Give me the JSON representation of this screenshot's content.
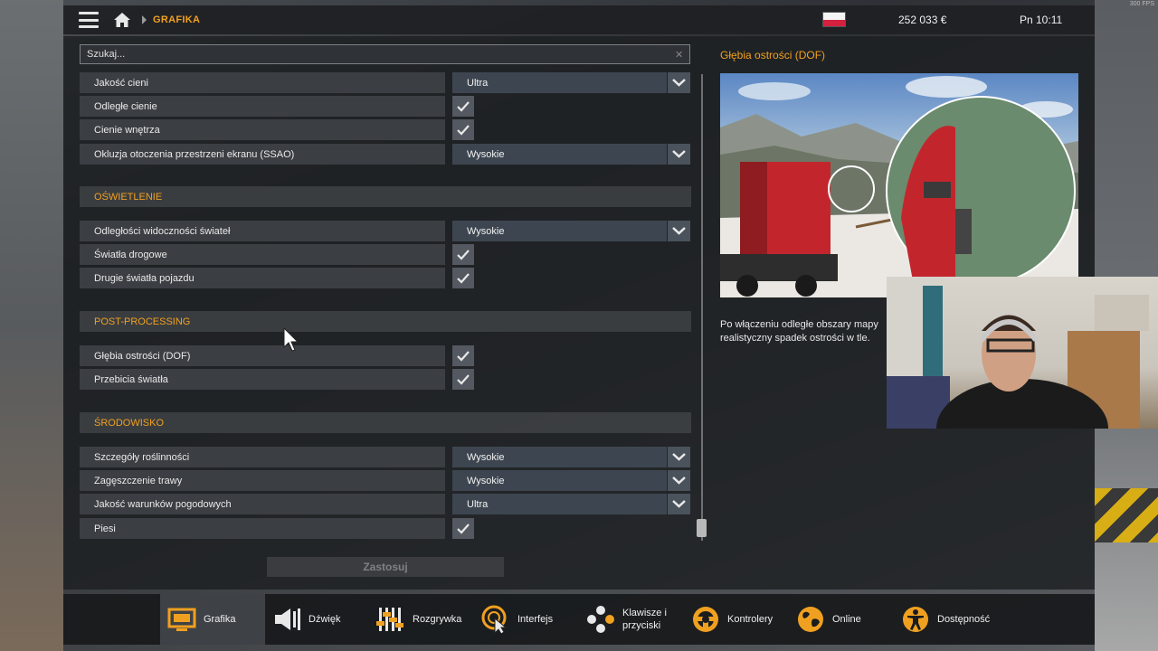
{
  "overlay": {
    "fps": "300 FPS"
  },
  "topbar": {
    "breadcrumb": "GRAFIKA",
    "money": "252 033 €",
    "clock": "Pn 10:11"
  },
  "search": {
    "placeholder": "Szukaj...",
    "value": ""
  },
  "settings": {
    "rows": [
      {
        "label": "Jakość cieni",
        "value": "Ultra"
      },
      {
        "label": "Odległe cienie",
        "checked": true
      },
      {
        "label": "Cienie wnętrza",
        "checked": true
      },
      {
        "label": "Okluzja otoczenia przestrzeni ekranu (SSAO)",
        "value": "Wysokie"
      }
    ],
    "lighting": {
      "title": "OŚWIETLENIE",
      "rows": [
        {
          "label": "Odległości widoczności świateł",
          "value": "Wysokie"
        },
        {
          "label": "Światła drogowe",
          "checked": true
        },
        {
          "label": "Drugie światła pojazdu",
          "checked": true
        }
      ]
    },
    "postprocessing": {
      "title": "POST-PROCESSING",
      "rows": [
        {
          "label": "Głębia ostrości (DOF)",
          "checked": true
        },
        {
          "label": "Przebicia światła",
          "checked": true
        }
      ]
    },
    "environment": {
      "title": "ŚRODOWISKO",
      "rows": [
        {
          "label": "Szczegóły roślinności",
          "value": "Wysokie"
        },
        {
          "label": "Zagęszczenie trawy",
          "value": "Wysokie"
        },
        {
          "label": "Jakość warunków pogodowych",
          "value": "Ultra"
        },
        {
          "label": "Piesi",
          "checked": true
        }
      ]
    }
  },
  "apply_button": "Zastosuj",
  "detail": {
    "title": "Głębia ostrości (DOF)",
    "description_line1": "Po włączeniu odległe obszary mapy",
    "description_line2": "realistyczny spadek ostrości w tle."
  },
  "nav": {
    "tabs": [
      {
        "label": "Grafika",
        "active": true
      },
      {
        "label": "Dźwięk"
      },
      {
        "label": "Rozgrywka"
      },
      {
        "label": "Interfejs"
      },
      {
        "label_line1": "Klawisze i",
        "label_line2": "przyciski"
      },
      {
        "label": "Kontrolery"
      },
      {
        "label": "Online"
      },
      {
        "label": "Dostępność"
      }
    ]
  },
  "colors": {
    "accent": "#f0a020",
    "select_bg": "#3d4650",
    "row_bg": "#3e4145"
  }
}
